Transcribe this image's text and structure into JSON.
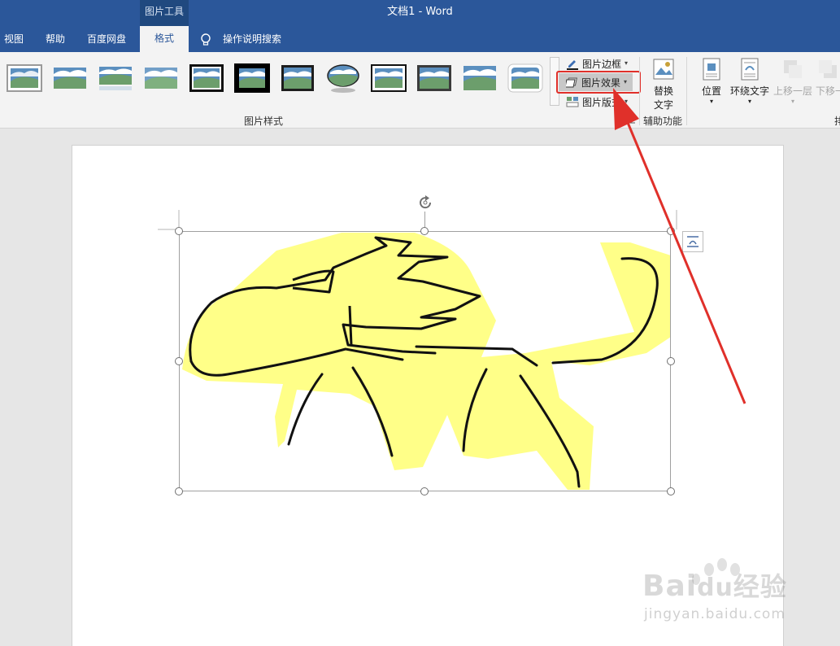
{
  "window": {
    "doc_title": "文档1  -  Word",
    "context_tab_header": "图片工具"
  },
  "tabs": {
    "view": "视图",
    "help": "帮助",
    "baidu_disk": "百度网盘",
    "format": "格式",
    "tell_me": "操作说明搜索"
  },
  "ribbon": {
    "picture_styles_label": "图片样式",
    "picture_border": "图片边框",
    "picture_effects": "图片效果",
    "picture_layout": "图片版式",
    "alt_text_line1": "替换",
    "alt_text_line2": "文字",
    "accessibility_label": "辅助功能",
    "position": "位置",
    "wrap_text": "环绕文字",
    "bring_forward": "上移一层",
    "send_backward": "下移一层",
    "arrange_label_fragment": "排"
  },
  "watermark": {
    "brand": "Bai",
    "brand_cn": "经验",
    "url": "jingyan.baidu.com"
  },
  "colors": {
    "title_blue": "#2b579a",
    "highlight_red": "#e0302a",
    "drawing_yellow": "#ffff88"
  }
}
